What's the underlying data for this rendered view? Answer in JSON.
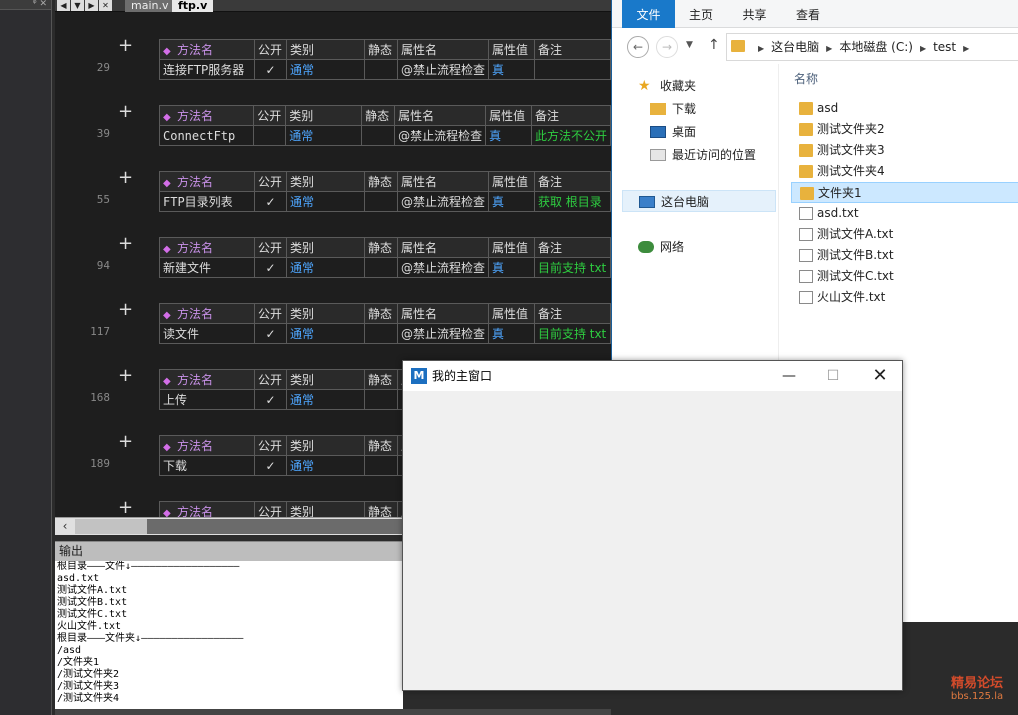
{
  "ide": {
    "tabs": [
      {
        "label": "main.v"
      },
      {
        "label": "ftp.v"
      }
    ],
    "columns": [
      "方法名",
      "公开",
      "类别",
      "静态",
      "属性名",
      "属性值",
      "备注"
    ],
    "methods": [
      {
        "line": "29",
        "name": "连接FTP服务器",
        "public": "✓",
        "category": "通常",
        "static": "",
        "attr_name": "@禁止流程检查",
        "attr_value": "真",
        "note": ""
      },
      {
        "line": "39",
        "name": "ConnectFtp",
        "public": "",
        "category": "通常",
        "static": "",
        "attr_name": "@禁止流程检查",
        "attr_value": "真",
        "note": "此方法不公开"
      },
      {
        "line": "55",
        "name": "FTP目录列表",
        "public": "✓",
        "category": "通常",
        "static": "",
        "attr_name": "@禁止流程检查",
        "attr_value": "真",
        "note": "获取 根目录"
      },
      {
        "line": "94",
        "name": "新建文件",
        "public": "✓",
        "category": "通常",
        "static": "",
        "attr_name": "@禁止流程检查",
        "attr_value": "真",
        "note": "目前支持 txt"
      },
      {
        "line": "117",
        "name": "读文件",
        "public": "✓",
        "category": "通常",
        "static": "",
        "attr_name": "@禁止流程检查",
        "attr_value": "真",
        "note": "目前支持 txt"
      },
      {
        "line": "168",
        "name": "上传",
        "public": "✓",
        "category": "通常",
        "static": "",
        "attr_name": "",
        "attr_value": "",
        "note": ""
      },
      {
        "line": "189",
        "name": "下载",
        "public": "✓",
        "category": "通常",
        "static": "",
        "attr_name": "",
        "attr_value": "",
        "note": ""
      },
      {
        "line": "",
        "name": "",
        "public": "",
        "category": "",
        "static": "",
        "attr_name": "",
        "attr_value": "",
        "note": ""
      }
    ],
    "output": {
      "title": "输出",
      "lines": [
        "根目录———文件↓——————————————————",
        "asd.txt",
        "测试文件A.txt",
        "测试文件B.txt",
        "测试文件C.txt",
        "火山文件.txt",
        "根目录———文件夹↓—————————————————",
        "/asd",
        "/文件夹1",
        "/测试文件夹2",
        "/测试文件夹3",
        "/测试文件夹4"
      ]
    }
  },
  "explorer": {
    "ribbon_tabs": [
      "文件",
      "主页",
      "共享",
      "查看"
    ],
    "breadcrumb": [
      "这台电脑",
      "本地磁盘 (C:)",
      "test"
    ],
    "nav": {
      "favorites": "收藏夹",
      "downloads": "下载",
      "desktop": "桌面",
      "recent": "最近访问的位置",
      "this_pc": "这台电脑",
      "network": "网络"
    },
    "column_name": "名称",
    "files": [
      {
        "name": "asd",
        "type": "folder"
      },
      {
        "name": "测试文件夹2",
        "type": "folder"
      },
      {
        "name": "测试文件夹3",
        "type": "folder"
      },
      {
        "name": "测试文件夹4",
        "type": "folder"
      },
      {
        "name": "文件夹1",
        "type": "folder",
        "selected": true
      },
      {
        "name": "asd.txt",
        "type": "file"
      },
      {
        "name": "测试文件A.txt",
        "type": "file"
      },
      {
        "name": "测试文件B.txt",
        "type": "file"
      },
      {
        "name": "测试文件C.txt",
        "type": "file"
      },
      {
        "name": "火山文件.txt",
        "type": "file"
      }
    ]
  },
  "dialog": {
    "title": "我的主窗口"
  },
  "watermark": {
    "title": "精易论坛",
    "url": "bbs.125.la"
  }
}
